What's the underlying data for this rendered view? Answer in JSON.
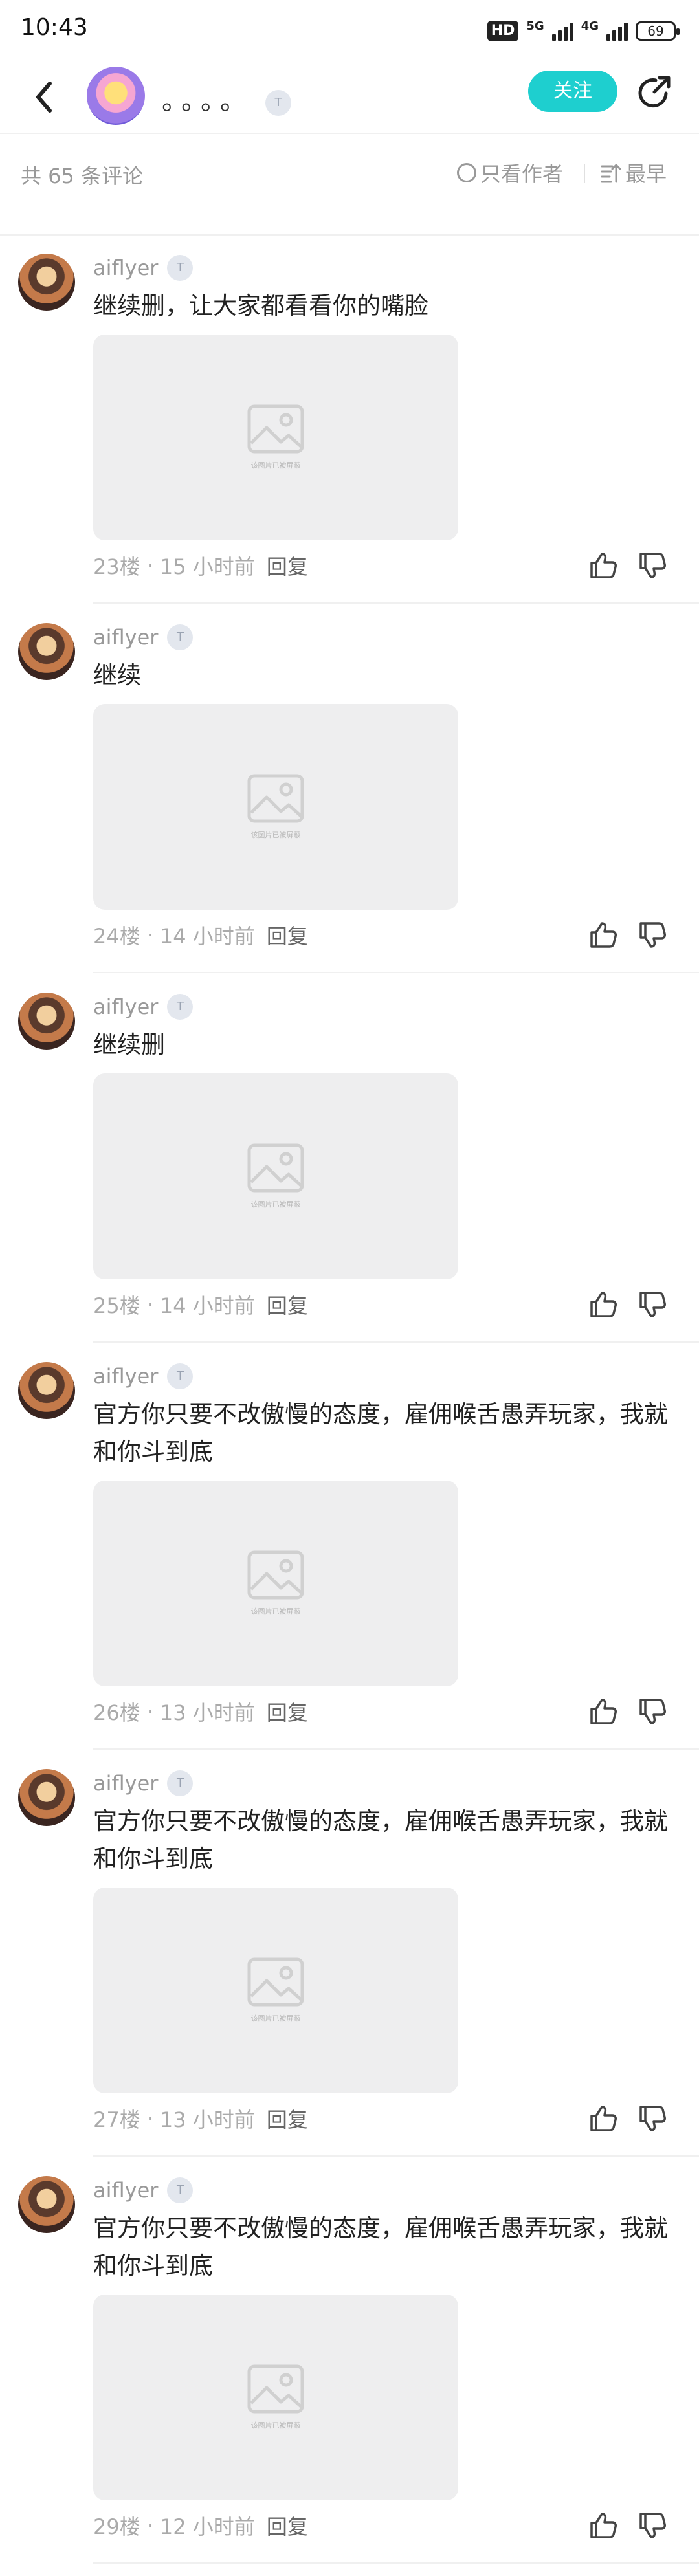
{
  "status_bar": {
    "time": "10:43",
    "hd": "HD",
    "net1": "5G",
    "net2": "4G",
    "battery": "69"
  },
  "header": {
    "title": "。。。。",
    "level_badge": "T",
    "follow_label": "关注",
    "accent_color": "#1ecfcf"
  },
  "filter": {
    "comment_count": "共 65 条评论",
    "only_author": "只看作者",
    "sort": "最早"
  },
  "comments": [
    {
      "user": "aiflyer",
      "level": "T",
      "text": "继续删，让大家都看看你的嘴脸",
      "image_caption": "该图片已被屏蔽",
      "floor": "23楼",
      "time": "15 小时前",
      "reply": "回复"
    },
    {
      "user": "aiflyer",
      "level": "T",
      "text": "继续",
      "image_caption": "该图片已被屏蔽",
      "floor": "24楼",
      "time": "14 小时前",
      "reply": "回复"
    },
    {
      "user": "aiflyer",
      "level": "T",
      "text": "继续删",
      "image_caption": "该图片已被屏蔽",
      "floor": "25楼",
      "time": "14 小时前",
      "reply": "回复"
    },
    {
      "user": "aiflyer",
      "level": "T",
      "text": "官方你只要不改傲慢的态度，雇佣喉舌愚弄玩家，我就和你斗到底",
      "image_caption": "该图片已被屏蔽",
      "floor": "26楼",
      "time": "13 小时前",
      "reply": "回复"
    },
    {
      "user": "aiflyer",
      "level": "T",
      "text": "官方你只要不改傲慢的态度，雇佣喉舌愚弄玩家，我就和你斗到底",
      "image_caption": "该图片已被屏蔽",
      "floor": "27楼",
      "time": "13 小时前",
      "reply": "回复"
    },
    {
      "user": "aiflyer",
      "level": "T",
      "text": "官方你只要不改傲慢的态度，雇佣喉舌愚弄玩家，我就和你斗到底",
      "image_caption": "该图片已被屏蔽",
      "floor": "29楼",
      "time": "12 小时前",
      "reply": "回复"
    }
  ]
}
